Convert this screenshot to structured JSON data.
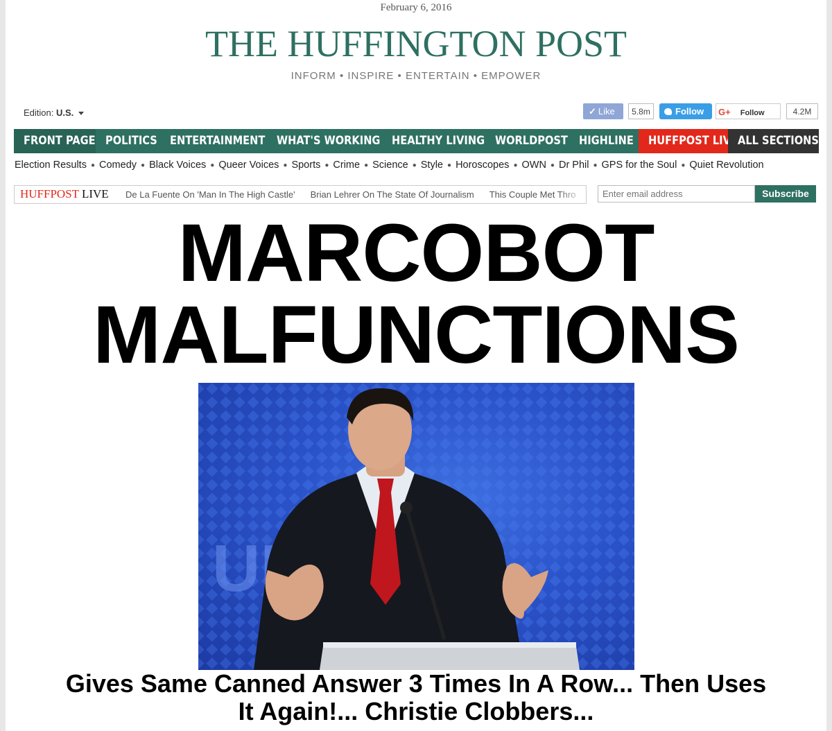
{
  "date": "February 6, 2016",
  "logo": "THE HUFFINGTON POST",
  "tagline": "INFORM • INSPIRE • ENTERTAIN • EMPOWER",
  "edition": {
    "label": "Edition:",
    "value": "U.S."
  },
  "social": {
    "facebook": {
      "label": "Like",
      "count": "5.8m",
      "icon": "check-icon"
    },
    "twitter": {
      "label": "Follow",
      "icon": "twitter-bird-icon"
    },
    "google": {
      "icon_text": "G+",
      "label": "Follow",
      "count": "4.2M"
    }
  },
  "colors": {
    "brand_green": "#2e7061",
    "live_red": "#e2281a",
    "all_sections_dark": "#333333"
  },
  "nav": {
    "items": [
      {
        "label": "FRONT PAGE"
      },
      {
        "label": "POLITICS"
      },
      {
        "label": "ENTERTAINMENT"
      },
      {
        "label": "WHAT'S WORKING"
      },
      {
        "label": "HEALTHY LIVING"
      },
      {
        "label": "WORLDPOST"
      },
      {
        "label": "HIGHLINE"
      },
      {
        "label": "HUFFPOST LIVE"
      },
      {
        "label": "ALL SECTIONS"
      }
    ]
  },
  "subnav": {
    "items": [
      "Election Results",
      "Comedy",
      "Black Voices",
      "Queer Voices",
      "Sports",
      "Crime",
      "Science",
      "Style",
      "Horoscopes",
      "OWN",
      "Dr Phil",
      "GPS for the Soul",
      "Quiet Revolution"
    ]
  },
  "live": {
    "logo_red": "HUFFPOST",
    "logo_black": "LIVE",
    "links": [
      "De La Fuente On 'Man In The High Castle'",
      "Brian Lehrer On The State Of Journalism",
      "This Couple Met Thro"
    ]
  },
  "newsletter": {
    "placeholder": "Enter email address",
    "button": "Subscribe"
  },
  "headline": {
    "line1": "MARCOBOT",
    "line2": "MALFUNCTIONS"
  },
  "photo": {
    "backdrop_text": "UR YOU"
  },
  "subhead": {
    "line1": "Gives Same Canned Answer 3 Times In A Row... Then Uses",
    "line2": "It Again!... Christie Clobbers..."
  }
}
